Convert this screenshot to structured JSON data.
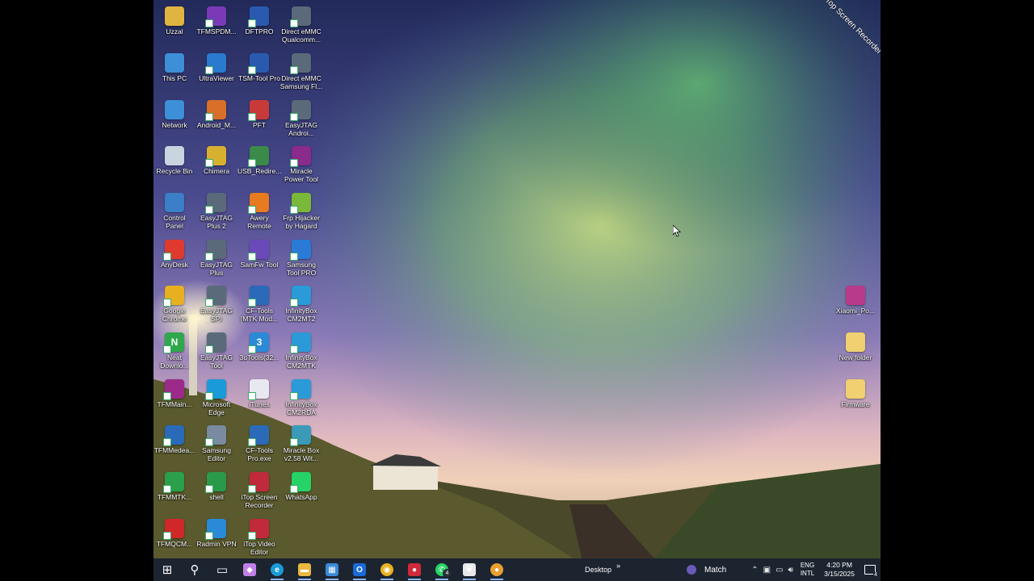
{
  "desktop_icons": [
    {
      "label": "Uzzal",
      "color": "#e0b440",
      "glyph": "",
      "shortcut": false
    },
    {
      "label": "This PC",
      "color": "#3d8fd8",
      "glyph": "",
      "shortcut": false
    },
    {
      "label": "Network",
      "color": "#3d8fd8",
      "glyph": "",
      "shortcut": false
    },
    {
      "label": "Recycle Bin",
      "color": "#c8d4e0",
      "glyph": "",
      "shortcut": false
    },
    {
      "label": "Control\nPanel",
      "color": "#3a7fc8",
      "glyph": "",
      "shortcut": false
    },
    {
      "label": "AnyDesk",
      "color": "#e03a2e",
      "glyph": "",
      "shortcut": true
    },
    {
      "label": "Google\nChrome",
      "color": "#e8b020",
      "glyph": "",
      "shortcut": true
    },
    {
      "label": "Neat\nDownlo...",
      "color": "#2ea84a",
      "glyph": "N",
      "shortcut": true
    },
    {
      "label": "TFMMain...",
      "color": "#9b2a8a",
      "glyph": "",
      "shortcut": true
    },
    {
      "label": "TFMMedea...",
      "color": "#2a6ab8",
      "glyph": "",
      "shortcut": true
    },
    {
      "label": "TFMMTK...",
      "color": "#2aa04a",
      "glyph": "",
      "shortcut": true
    },
    {
      "label": "TFMQCM...",
      "color": "#d02828",
      "glyph": "",
      "shortcut": true
    },
    {
      "label": "TFMSPDM...",
      "color": "#7a3ab8",
      "glyph": "",
      "shortcut": true
    },
    {
      "label": "UltraViewer",
      "color": "#2a7ad0",
      "glyph": "",
      "shortcut": true
    },
    {
      "label": "Android_M...",
      "color": "#d8702a",
      "glyph": "",
      "shortcut": true
    },
    {
      "label": "Chimera",
      "color": "#d8b030",
      "glyph": "",
      "shortcut": true
    },
    {
      "label": "EasyJTAG\nPlus 2",
      "color": "#5a6a7a",
      "glyph": "",
      "shortcut": true
    },
    {
      "label": "EasyJTAG\nPlus",
      "color": "#5a6a7a",
      "glyph": "",
      "shortcut": true
    },
    {
      "label": "EasyJTAG SPI\nFlasher",
      "color": "#5a6a7a",
      "glyph": "",
      "shortcut": true
    },
    {
      "label": "EasyJTAG\nTool",
      "color": "#5a6a7a",
      "glyph": "",
      "shortcut": true
    },
    {
      "label": "Microsoft\nEdge",
      "color": "#1a9ad8",
      "glyph": "",
      "shortcut": true
    },
    {
      "label": "Samsung\nEditor",
      "color": "#7a8aa0",
      "glyph": "",
      "shortcut": true
    },
    {
      "label": "shell",
      "color": "#2a9a4a",
      "glyph": "",
      "shortcut": true
    },
    {
      "label": "Radmin VPN",
      "color": "#2a8ad8",
      "glyph": "",
      "shortcut": true
    },
    {
      "label": "DFTPRO",
      "color": "#2a5ab0",
      "glyph": "",
      "shortcut": true
    },
    {
      "label": "TSM-Tool Pro",
      "color": "#2a5ab0",
      "glyph": "",
      "shortcut": true
    },
    {
      "label": "PFT",
      "color": "#c83a3a",
      "glyph": "",
      "shortcut": true
    },
    {
      "label": "USB_Redire...",
      "color": "#3a8a4a",
      "glyph": "",
      "shortcut": true
    },
    {
      "label": "Awery\nRemote",
      "color": "#e87a20",
      "glyph": "",
      "shortcut": true
    },
    {
      "label": "SamFw Tool",
      "color": "#6a4ab8",
      "glyph": "",
      "shortcut": true
    },
    {
      "label": "CF-Tools\n[MTK Mod...",
      "color": "#2a6ab8",
      "glyph": "",
      "shortcut": true
    },
    {
      "label": "3uTools(32...",
      "color": "#2a8ad8",
      "glyph": "3",
      "shortcut": true
    },
    {
      "label": "iTunes",
      "color": "#e8e8f0",
      "glyph": "",
      "shortcut": true
    },
    {
      "label": "CF-Tools\nPro.exe",
      "color": "#2a6ab8",
      "glyph": "",
      "shortcut": true
    },
    {
      "label": "iTop Screen\nRecorder",
      "color": "#c02a3a",
      "glyph": "",
      "shortcut": true
    },
    {
      "label": "iTop Video\nEditor",
      "color": "#c02a3a",
      "glyph": "",
      "shortcut": true
    },
    {
      "label": "Direct eMMC\nQualcomm...",
      "color": "#5a6a7a",
      "glyph": "",
      "shortcut": true
    },
    {
      "label": "Direct eMMC\nSamsung Fl...",
      "color": "#5a6a7a",
      "glyph": "",
      "shortcut": true
    },
    {
      "label": "EasyJTAG\nAndroi...",
      "color": "#5a6a7a",
      "glyph": "",
      "shortcut": true
    },
    {
      "label": "Miracle\nPower Tool",
      "color": "#8a2a8a",
      "glyph": "",
      "shortcut": true
    },
    {
      "label": "Frp Hijacker\nby Hagard",
      "color": "#7ab83a",
      "glyph": "",
      "shortcut": true
    },
    {
      "label": "Samsung\nTool PRO",
      "color": "#2a7ad8",
      "glyph": "",
      "shortcut": true
    },
    {
      "label": "InfinityBox\nCM2MT2",
      "color": "#2a9ad8",
      "glyph": "",
      "shortcut": true
    },
    {
      "label": "InfinityBox\nCM2MTK",
      "color": "#2a9ad8",
      "glyph": "",
      "shortcut": true
    },
    {
      "label": "InfinityBox\nCM2RDA",
      "color": "#2a9ad8",
      "glyph": "",
      "shortcut": true
    },
    {
      "label": "Miracle Box\nv2.58 Wit...",
      "color": "#3a9ab8",
      "glyph": "",
      "shortcut": true
    },
    {
      "label": "WhatsApp",
      "color": "#25d366",
      "glyph": "",
      "shortcut": true
    },
    {
      "label": "Xiaomi_Po...",
      "color": "#b83a8a",
      "glyph": "",
      "shortcut": false
    },
    {
      "label": "New folder",
      "color": "#f0d070",
      "glyph": "",
      "shortcut": false
    },
    {
      "label": "Firmware",
      "color": "#f0d070",
      "glyph": "",
      "shortcut": false
    }
  ],
  "taskbar": {
    "apps": [
      {
        "name": "start",
        "icon": "windows-logo-icon",
        "color": "#ffffff"
      },
      {
        "name": "search",
        "icon": "search-icon",
        "color": "#ffffff"
      },
      {
        "name": "task-view",
        "icon": "task-view-icon",
        "color": "#ffffff"
      },
      {
        "name": "copilot",
        "icon": "copilot-icon",
        "color": "#c080e8"
      },
      {
        "name": "edge",
        "icon": "edge-icon",
        "color": "#1a9ad8"
      },
      {
        "name": "file-explorer",
        "icon": "folder-icon",
        "color": "#e8b840"
      },
      {
        "name": "store",
        "icon": "store-icon",
        "color": "#3a8ad8"
      },
      {
        "name": "outlook",
        "icon": "outlook-icon",
        "color": "#1a6ad8"
      },
      {
        "name": "chrome",
        "icon": "chrome-icon",
        "color": "#e8b020"
      },
      {
        "name": "itop-recorder",
        "icon": "record-icon",
        "color": "#d02a3a"
      },
      {
        "name": "whatsapp",
        "icon": "whatsapp-icon",
        "color": "#25d366",
        "badge": "4"
      },
      {
        "name": "security",
        "icon": "shield-icon",
        "color": "#e8e8e8"
      },
      {
        "name": "app-orange",
        "icon": "circle-app-icon",
        "color": "#e8a030"
      }
    ],
    "desktop_label": "Desktop",
    "desktop_chevron": "»",
    "weather_label": "Match",
    "lang_line1": "ENG",
    "lang_line2": "INTL",
    "time": "4:20 PM",
    "date": "3/15/2025",
    "notification_badge": "4"
  },
  "watermark": "iTop Screen Recorder"
}
